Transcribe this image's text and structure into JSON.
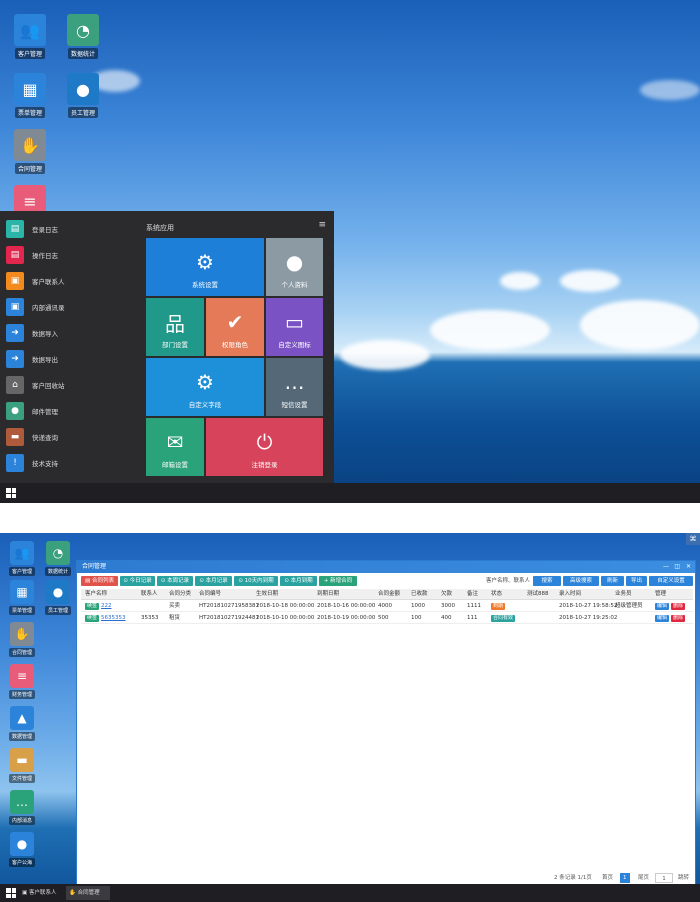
{
  "desktop_top": {
    "icons": [
      {
        "label": "客户管理",
        "color": "#2b83da",
        "glyph": "👥",
        "icon": "users-icon"
      },
      {
        "label": "数据统计",
        "color": "#3aa07e",
        "glyph": "◔",
        "icon": "pie-chart-icon"
      },
      {
        "label": "票单管理",
        "color": "#2b83da",
        "glyph": "▦",
        "icon": "calculator-icon"
      },
      {
        "label": "员工管理",
        "color": "#1e7ac6",
        "glyph": "●",
        "icon": "user-icon"
      },
      {
        "label": "合同管理",
        "color": "#7f8a95",
        "glyph": "✋",
        "icon": "handshake-icon"
      },
      {
        "label": "",
        "color": "#e85c7a",
        "glyph": "≡",
        "icon": "database-icon"
      }
    ]
  },
  "start_menu": {
    "section_title": "系统应用",
    "menu_glyph": "≡",
    "items": [
      {
        "label": "登录日志",
        "color": "#2bb5a8",
        "glyph": "▤",
        "icon": "log-icon"
      },
      {
        "label": "操作日志",
        "color": "#e2264d",
        "glyph": "▤",
        "icon": "doc-icon"
      },
      {
        "label": "客户联系人",
        "color": "#f28a1d",
        "glyph": "▣",
        "icon": "contact-card-icon"
      },
      {
        "label": "内部通讯录",
        "color": "#2b83da",
        "glyph": "▣",
        "icon": "address-book-icon"
      },
      {
        "label": "数据导入",
        "color": "#2b83da",
        "glyph": "➜",
        "icon": "import-icon"
      },
      {
        "label": "数据导出",
        "color": "#2b83da",
        "glyph": "➜",
        "icon": "export-icon"
      },
      {
        "label": "客户回收站",
        "color": "#666",
        "glyph": "⌂",
        "icon": "bank-icon"
      },
      {
        "label": "邮件管理",
        "color": "#3aa07e",
        "glyph": "●",
        "icon": "person-icon"
      },
      {
        "label": "快递查询",
        "color": "#b05a3c",
        "glyph": "▬",
        "icon": "truck-icon"
      },
      {
        "label": "技术支持",
        "color": "#2b83da",
        "glyph": "!",
        "icon": "info-icon"
      }
    ],
    "tiles": [
      {
        "label": "系统设置",
        "color": "#1e7fd9",
        "glyph": "⚙",
        "icon": "gear-icon"
      },
      {
        "label": "个人资料",
        "color": "#8b9aa3",
        "glyph": "●",
        "icon": "avatar-icon"
      },
      {
        "label": "部门设置",
        "color": "#21998a",
        "glyph": "品",
        "icon": "org-chart-icon"
      },
      {
        "label": "权限角色",
        "color": "#e47a57",
        "glyph": "✔",
        "icon": "check-icon"
      },
      {
        "label": "自定义图标",
        "color": "#7b52c4",
        "glyph": "▭",
        "icon": "monitor-icon"
      },
      {
        "label": "自定义字段",
        "color": "#1e90d9",
        "glyph": "⚙",
        "icon": "gears-icon"
      },
      {
        "label": "短信设置",
        "color": "#546878",
        "glyph": "…",
        "icon": "chat-icon"
      },
      {
        "label": "邮箱设置",
        "color": "#2aa27a",
        "glyph": "✉",
        "icon": "mail-icon"
      },
      {
        "label": "注销登录",
        "color": "#d6435a",
        "glyph": "⏻",
        "icon": "power-icon"
      }
    ]
  },
  "desktop_bottom": {
    "icons": [
      {
        "label": "客户管理",
        "color": "#2b83da",
        "glyph": "👥",
        "icon": "users-icon"
      },
      {
        "label": "数据统计",
        "color": "#3aa07e",
        "glyph": "◔",
        "icon": "pie-chart-icon"
      },
      {
        "label": "票单管理",
        "color": "#2b83da",
        "glyph": "▦",
        "icon": "calculator-icon"
      },
      {
        "label": "员工管理",
        "color": "#1e7ac6",
        "glyph": "●",
        "icon": "user-icon"
      },
      {
        "label": "合同管理",
        "color": "#7f8a95",
        "glyph": "✋",
        "icon": "handshake-icon"
      },
      {
        "label": "财务管理",
        "color": "#e85c7a",
        "glyph": "≡",
        "icon": "database-icon"
      },
      {
        "label": "数据管理",
        "color": "#2b83da",
        "glyph": "▲",
        "icon": "warning-icon"
      },
      {
        "label": "文件管理",
        "color": "#d9a04a",
        "glyph": "▬",
        "icon": "folder-icon"
      },
      {
        "label": "内部消息",
        "color": "#2aa27a",
        "glyph": "…",
        "icon": "message-icon"
      },
      {
        "label": "客户公海",
        "color": "#2b83da",
        "glyph": "●",
        "icon": "person-icon"
      }
    ],
    "taskbar_items": [
      "客户联系人",
      "合同管理"
    ]
  },
  "contract_window": {
    "title": "合同管理",
    "toolbar": [
      "合同列表",
      "今日记录",
      "本周记录",
      "本月记录",
      "10天内到期",
      "本月到期",
      "新增合同"
    ],
    "search_placeholder": "客户名称、联系人",
    "right_buttons": [
      "搜索",
      "高级搜索",
      "刷新",
      "导出",
      "自定义设置"
    ],
    "columns": [
      "客户名称",
      "联系人",
      "合同分类",
      "合同编号",
      "生效日期",
      "到期日期",
      "合同金额",
      "已收款",
      "欠款",
      "备注",
      "状态",
      "测试888",
      "录入时间",
      "业务员",
      "管理"
    ],
    "rows": [
      {
        "tag": "续签",
        "name": "222",
        "contact": "",
        "category": "买卖",
        "number": "HT20181027195838​1",
        "start": "2018-10-18 00:00:00",
        "end": "2018-10-16 00:00:00",
        "amount": "4000",
        "received": "1000",
        "owed": "3000",
        "note": "1111",
        "status": "到期",
        "test": "",
        "created": "2018-10-27 19:58:52",
        "staff": "超级管理员"
      },
      {
        "tag": "续签",
        "name": "5635353",
        "contact": "35353",
        "category": "租赁",
        "number": "HT20181027192448​1",
        "start": "2018-10-10 00:00:00",
        "end": "2018-10-19 00:00:00",
        "amount": "500",
        "received": "100",
        "owed": "400",
        "note": "111",
        "status": "合同有效",
        "test": "",
        "created": "2018-10-27 19:25:02",
        "staff": ""
      }
    ],
    "edit_label": "编辑",
    "delete_label": "删除",
    "pagination": {
      "summary": "2 条记录 1/1页",
      "first": "首页",
      "current": "1",
      "last": "尾页",
      "page_input": "1",
      "jump": "跳转"
    }
  }
}
